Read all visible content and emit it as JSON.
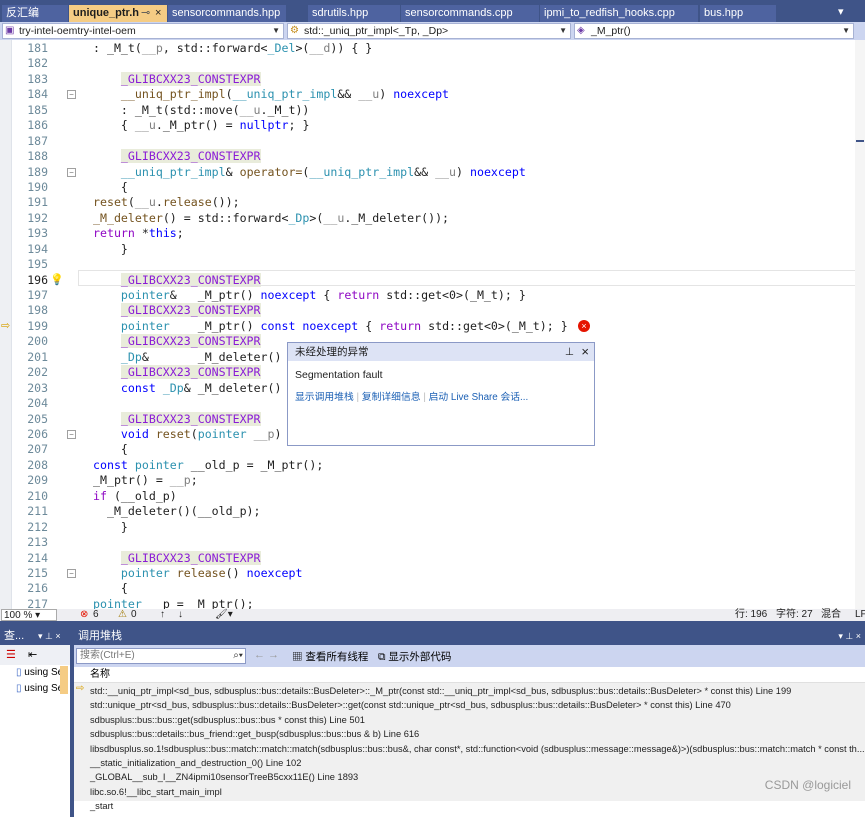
{
  "tabs": [
    {
      "label": "反汇编"
    },
    {
      "label": "unique_ptr.h",
      "active": true
    },
    {
      "label": "sensorcommands.hpp"
    },
    {
      "label": "sdrutils.hpp"
    },
    {
      "label": "sensorcommands.cpp"
    },
    {
      "label": "ipmi_to_redfish_hooks.cpp"
    },
    {
      "label": "bus.hpp"
    }
  ],
  "nav": {
    "project": "try-intel-oemtry-intel-oem",
    "scope": "std::_uniq_ptr_impl<_Tp, _Dp>",
    "member": "_M_ptr()"
  },
  "code_lines": [
    {
      "n": "181",
      "s": [
        [
          ": _M_t(",
          ""
        ],
        [
          "__p",
          "pa"
        ],
        [
          ", std::forward<",
          ""
        ],
        [
          "_Del",
          "ty"
        ],
        [
          ">(",
          ""
        ],
        [
          "__d",
          "pa"
        ],
        [
          ")) { }",
          ""
        ]
      ]
    },
    {
      "n": "182",
      "s": []
    },
    {
      "n": "183",
      "s": [
        [
          "    ",
          ""
        ],
        [
          "_GLIBCXX23_CONSTEXPR",
          "mac"
        ]
      ]
    },
    {
      "n": "184",
      "fold": true,
      "s": [
        [
          "    ",
          ""
        ],
        [
          "__uniq_ptr_impl",
          "fn"
        ],
        [
          "(",
          ""
        ],
        [
          "__uniq_ptr_impl",
          "ty"
        ],
        [
          "&& ",
          ""
        ],
        [
          "__u",
          "pa"
        ],
        [
          ") ",
          ""
        ],
        [
          "noexcept",
          "kw"
        ]
      ]
    },
    {
      "n": "185",
      "s": [
        [
          "    : _M_t(std::move(",
          ""
        ],
        [
          "__u",
          "pa"
        ],
        [
          "._M_t))",
          ""
        ]
      ]
    },
    {
      "n": "186",
      "s": [
        [
          "    { ",
          ""
        ],
        [
          "__u",
          "pa"
        ],
        [
          "._M_ptr() = ",
          ""
        ],
        [
          "nullptr",
          "kw"
        ],
        [
          "; }",
          ""
        ]
      ]
    },
    {
      "n": "187",
      "s": []
    },
    {
      "n": "188",
      "s": [
        [
          "    ",
          ""
        ],
        [
          "_GLIBCXX23_CONSTEXPR",
          "mac"
        ]
      ]
    },
    {
      "n": "189",
      "fold": true,
      "s": [
        [
          "    ",
          ""
        ],
        [
          "__uniq_ptr_impl",
          "ty"
        ],
        [
          "& ",
          ""
        ],
        [
          "operator=",
          "fn"
        ],
        [
          "(",
          ""
        ],
        [
          "__uniq_ptr_impl",
          "ty"
        ],
        [
          "&& ",
          ""
        ],
        [
          "__u",
          "pa"
        ],
        [
          ") ",
          ""
        ],
        [
          "noexcept",
          "kw"
        ]
      ]
    },
    {
      "n": "190",
      "s": [
        [
          "    {",
          ""
        ]
      ]
    },
    {
      "n": "191",
      "s": [
        [
          "reset",
          "fn"
        ],
        [
          "(",
          ""
        ],
        [
          "__u",
          "pa"
        ],
        [
          ".",
          ""
        ],
        [
          "release",
          "fn"
        ],
        [
          "());",
          ""
        ]
      ]
    },
    {
      "n": "192",
      "s": [
        [
          "_M_deleter",
          "fn"
        ],
        [
          "() = std::forward<",
          ""
        ],
        [
          "_Dp",
          "ty"
        ],
        [
          ">(",
          ""
        ],
        [
          "__u",
          "pa"
        ],
        [
          "._M_deleter());",
          ""
        ]
      ]
    },
    {
      "n": "193",
      "s": [
        [
          "return",
          "ck"
        ],
        [
          " *",
          ""
        ],
        [
          "this",
          "kw"
        ],
        [
          ";",
          ""
        ]
      ]
    },
    {
      "n": "194",
      "s": [
        [
          "    }",
          ""
        ]
      ]
    },
    {
      "n": "195",
      "s": []
    },
    {
      "n": "196",
      "cur": true,
      "s": [
        [
          "    ",
          ""
        ],
        [
          "_GLIBCXX23_CONSTEXPR",
          "mac"
        ]
      ]
    },
    {
      "n": "197",
      "s": [
        [
          "    ",
          ""
        ],
        [
          "pointer",
          "ty"
        ],
        [
          "&   _M_ptr() ",
          ""
        ],
        [
          "noexcept",
          "kw"
        ],
        [
          " { ",
          ""
        ],
        [
          "return",
          "ck"
        ],
        [
          " std::get<0>(_M_t); }",
          ""
        ]
      ]
    },
    {
      "n": "198",
      "s": [
        [
          "    ",
          ""
        ],
        [
          "_GLIBCXX23_CONSTEXPR",
          "mac"
        ]
      ]
    },
    {
      "n": "199",
      "arrow": true,
      "err": true,
      "s": [
        [
          "    ",
          ""
        ],
        [
          "pointer",
          "ty"
        ],
        [
          "    _M_ptr() ",
          ""
        ],
        [
          "const noexcept",
          "kw"
        ],
        [
          " { ",
          ""
        ],
        [
          "return",
          "ck"
        ],
        [
          " std::get<0>(_M_t); }",
          ""
        ]
      ]
    },
    {
      "n": "200",
      "s": [
        [
          "    ",
          ""
        ],
        [
          "_GLIBCXX23_CONSTEXPR",
          "mac"
        ]
      ]
    },
    {
      "n": "201",
      "s": [
        [
          "    ",
          ""
        ],
        [
          "_Dp",
          "ty"
        ],
        [
          "&       _M_deleter()",
          ""
        ]
      ]
    },
    {
      "n": "202",
      "s": [
        [
          "    ",
          ""
        ],
        [
          "_GLIBCXX23_CONSTEXPR",
          "mac"
        ]
      ]
    },
    {
      "n": "203",
      "s": [
        [
          "    ",
          ""
        ],
        [
          "const",
          "kw"
        ],
        [
          " ",
          ""
        ],
        [
          "_Dp",
          "ty"
        ],
        [
          "& _M_deleter()",
          ""
        ]
      ]
    },
    {
      "n": "204",
      "s": []
    },
    {
      "n": "205",
      "s": [
        [
          "    ",
          ""
        ],
        [
          "_GLIBCXX23_CONSTEXPR",
          "mac"
        ]
      ]
    },
    {
      "n": "206",
      "fold": true,
      "s": [
        [
          "    ",
          ""
        ],
        [
          "void",
          "kw"
        ],
        [
          " ",
          ""
        ],
        [
          "reset",
          "fn"
        ],
        [
          "(",
          ""
        ],
        [
          "pointer",
          "ty"
        ],
        [
          " ",
          ""
        ],
        [
          "__p",
          "pa"
        ],
        [
          ") ",
          ""
        ],
        [
          "noexcept",
          "kw"
        ]
      ]
    },
    {
      "n": "207",
      "s": [
        [
          "    {",
          ""
        ]
      ]
    },
    {
      "n": "208",
      "s": [
        [
          "const",
          "kw"
        ],
        [
          " ",
          ""
        ],
        [
          "pointer",
          "ty"
        ],
        [
          " __old_p = _M_ptr();",
          ""
        ]
      ]
    },
    {
      "n": "209",
      "s": [
        [
          "_M_ptr() = ",
          ""
        ],
        [
          "__p",
          "pa"
        ],
        [
          ";",
          ""
        ]
      ]
    },
    {
      "n": "210",
      "s": [
        [
          "if",
          "ck"
        ],
        [
          " (__old_p)",
          ""
        ]
      ]
    },
    {
      "n": "211",
      "s": [
        [
          "  _M_deleter()(__old_p);",
          ""
        ]
      ]
    },
    {
      "n": "212",
      "s": [
        [
          "    }",
          ""
        ]
      ]
    },
    {
      "n": "213",
      "s": []
    },
    {
      "n": "214",
      "s": [
        [
          "    ",
          ""
        ],
        [
          "_GLIBCXX23_CONSTEXPR",
          "mac"
        ]
      ]
    },
    {
      "n": "215",
      "fold": true,
      "s": [
        [
          "    ",
          ""
        ],
        [
          "pointer",
          "ty"
        ],
        [
          " ",
          ""
        ],
        [
          "release",
          "fn"
        ],
        [
          "() ",
          ""
        ],
        [
          "noexcept",
          "kw"
        ]
      ]
    },
    {
      "n": "216",
      "s": [
        [
          "    {",
          ""
        ]
      ]
    },
    {
      "n": "217",
      "s": [
        [
          "pointer",
          "ty"
        ],
        [
          " __p = _M_ptr();",
          ""
        ]
      ]
    }
  ],
  "exception_popup": {
    "title": "未经处理的异常",
    "message": "Segmentation fault",
    "links": [
      "显示调用堆栈",
      "复制详细信息",
      "启动 Live Share 会话..."
    ]
  },
  "status": {
    "zoom": "100 %",
    "errors": "6",
    "warnings": "0",
    "line": "行: 196",
    "char": "字符: 27",
    "mode": "混合",
    "eol": "LF"
  },
  "left_panel": {
    "title": "查...",
    "items": [
      "using Se",
      "using Se"
    ]
  },
  "call_stack": {
    "title": "调用堆栈",
    "search_placeholder": "搜索(Ctrl+E)",
    "view_all_threads": "查看所有线程",
    "show_external_code": "显示外部代码",
    "column": "名称",
    "frames": [
      "std::__uniq_ptr_impl<sd_bus, sdbusplus::bus::details::BusDeleter>::_M_ptr(const std::__uniq_ptr_impl<sd_bus, sdbusplus::bus::details::BusDeleter> * const this) Line 199",
      "std::unique_ptr<sd_bus, sdbusplus::bus::details::BusDeleter>::get(const std::unique_ptr<sd_bus, sdbusplus::bus::details::BusDeleter> * const this) Line 470",
      "sdbusplus::bus::bus::get(sdbusplus::bus::bus * const this) Line 501",
      "sdbusplus::bus::details::bus_friend::get_busp(sdbusplus::bus::bus & b) Line 616",
      "libsdbusplus.so.1!sdbusplus::bus::match::match::match(sdbusplus::bus::bus&, char const*, std::function<void (sdbusplus::message::message&)>)(sdbusplus::bus::match::match * const th...",
      "__static_initialization_and_destruction_0() Line 102",
      "_GLOBAL__sub_I__ZN4ipmi10sensorTreeB5cxx11E() Line 1893",
      "libc.so.6!__libc_start_main_impl",
      "_start"
    ]
  },
  "watermark": "CSDN @logiciel",
  "colors": {
    "chrome": "#3f5488",
    "active_tab": "#f5cc84",
    "macro": "#8a1bd6",
    "type": "#2b91af",
    "keyword": "#0000ff",
    "error": "#e51400"
  }
}
